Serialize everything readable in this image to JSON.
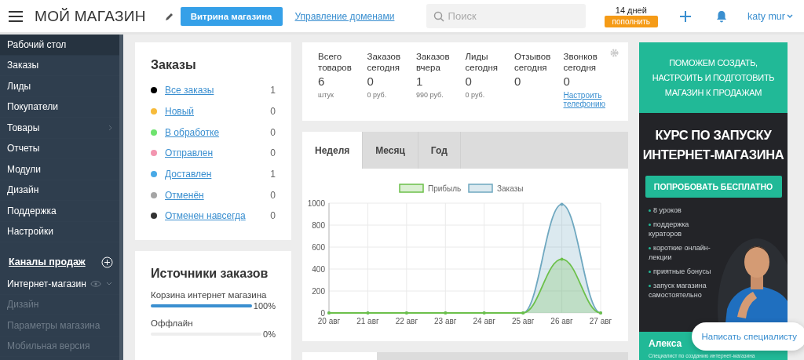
{
  "header": {
    "title": "МОЙ МАГАЗИН",
    "storefront_button": "Витрина магазина",
    "domains_link": "Управление доменами",
    "search": {
      "placeholder": "Поиск"
    },
    "balance": {
      "days": "14 дней",
      "button": "пополнить"
    },
    "user": "katy mur"
  },
  "sidebar": {
    "items": [
      {
        "label": "Рабочий стол",
        "selected": true
      },
      {
        "label": "Заказы",
        "selected": false
      },
      {
        "label": "Лиды",
        "selected": false
      },
      {
        "label": "Покупатели",
        "selected": false
      },
      {
        "label": "Товары",
        "selected": false,
        "submenu": true
      },
      {
        "label": "Отчеты",
        "selected": false
      },
      {
        "label": "Модули",
        "selected": false
      },
      {
        "label": "Дизайн",
        "selected": false
      },
      {
        "label": "Поддержка",
        "selected": false
      },
      {
        "label": "Настройки",
        "selected": false
      }
    ],
    "channels_title": "Каналы продаж",
    "channels": [
      {
        "label": "Интернет-магазин",
        "expanded": true,
        "children": [
          {
            "label": "Дизайн"
          },
          {
            "label": "Параметры магазина"
          },
          {
            "label": "Мобильная версия"
          }
        ]
      }
    ]
  },
  "orders": {
    "title": "Заказы",
    "statuses": [
      {
        "label": "Все заказы",
        "count": "1",
        "color": "#000000"
      },
      {
        "label": "Новый",
        "count": "0",
        "color": "#f7bb3b"
      },
      {
        "label": "В обработке",
        "count": "0",
        "color": "#6ee36e"
      },
      {
        "label": "Отправлен",
        "count": "0",
        "color": "#f395b0"
      },
      {
        "label": "Доставлен",
        "count": "1",
        "color": "#48a9e6"
      },
      {
        "label": "Отменён",
        "count": "0",
        "color": "#a5a5a5"
      },
      {
        "label": "Отменен навсегда",
        "count": "0",
        "color": "#333333"
      }
    ]
  },
  "sources": {
    "title": "Источники заказов",
    "items": [
      {
        "label": "Корзина интернет магазина",
        "reading": "100%",
        "level": 1
      },
      {
        "label": "Оффлайн",
        "reading": "0%",
        "level": 0
      }
    ]
  },
  "stats": [
    {
      "label": "Всего товаров",
      "value": "6",
      "note": "штук"
    },
    {
      "label": "Заказов сегодня",
      "value": "0",
      "note": "0 руб."
    },
    {
      "label": "Заказов вчера",
      "value": "1",
      "note": "990 руб."
    },
    {
      "label": "Лиды сегодня",
      "value": "0",
      "note": "0 руб."
    },
    {
      "label": "Отзывов сегодня",
      "value": "0"
    },
    {
      "label": "Звонков сегодня",
      "value": "0",
      "link": "Настроить телефонию"
    }
  ],
  "chart_tabs": [
    {
      "label": "Неделя",
      "selected": true
    },
    {
      "label": "Месяц",
      "selected": false
    },
    {
      "label": "Год",
      "selected": false
    }
  ],
  "chart_data": {
    "type": "area",
    "categories": [
      "20 авг",
      "21 авг",
      "22 авг",
      "23 авг",
      "24 авг",
      "25 авг",
      "26 авг",
      "27 авг"
    ],
    "series": [
      {
        "name": "Прибыль",
        "color": "#6cc04a",
        "values": [
          0,
          0,
          0,
          0,
          0,
          0,
          490,
          0
        ]
      },
      {
        "name": "Заказы",
        "color": "#6fa8c0",
        "values": [
          0,
          0,
          0,
          0,
          0,
          0,
          990,
          0
        ]
      }
    ],
    "ylim": [
      0,
      1000
    ],
    "yticks": [
      {
        "value": 0,
        "label": "0"
      },
      {
        "value": 200,
        "label": "200"
      },
      {
        "value": 400,
        "label": "400"
      },
      {
        "value": 600,
        "label": "600"
      },
      {
        "value": 800,
        "label": "800"
      },
      {
        "value": 1000,
        "label": "1000"
      }
    ],
    "grid": true,
    "legend": true
  },
  "banner": {
    "headline": "ПОМОЖЕМ СОЗДАТЬ, НАСТРОИТЬ И ПОДГОТОВИТЬ МАГАЗИН К ПРОДАЖАМ",
    "title": "КУРС ПО ЗАПУСКУ ИНТЕРНЕТ-МАГАЗИНА",
    "button": "ПОПРОБОВАТЬ БЕСПЛАТНО",
    "bullets": [
      "8 уроков",
      "поддержка кураторов",
      "короткие онлайн-лекции",
      "приятные бонусы",
      "запуск магазина самостоятельно"
    ],
    "author": "Алекса",
    "author_role": "Специалист по созданию интернет-магазина"
  },
  "chat_button": "Написать специалисту"
}
